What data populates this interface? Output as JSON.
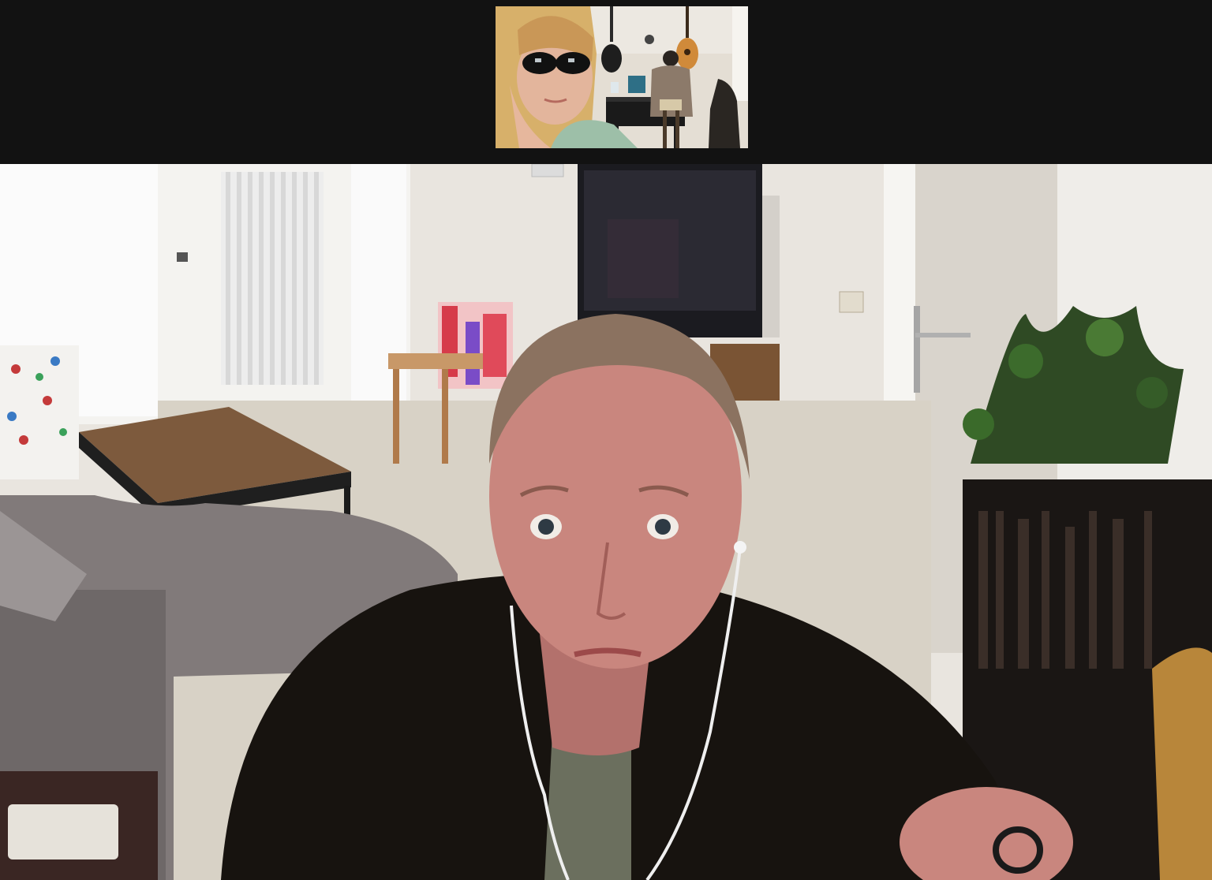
{
  "app": {
    "type": "video-call",
    "layout": "speaker-view"
  },
  "colors": {
    "background": "#121212"
  },
  "participants": [
    {
      "id": "thumbnail",
      "view": "thumbnail",
      "name_visible": false
    },
    {
      "id": "active-speaker",
      "view": "main",
      "name_visible": false
    }
  ]
}
